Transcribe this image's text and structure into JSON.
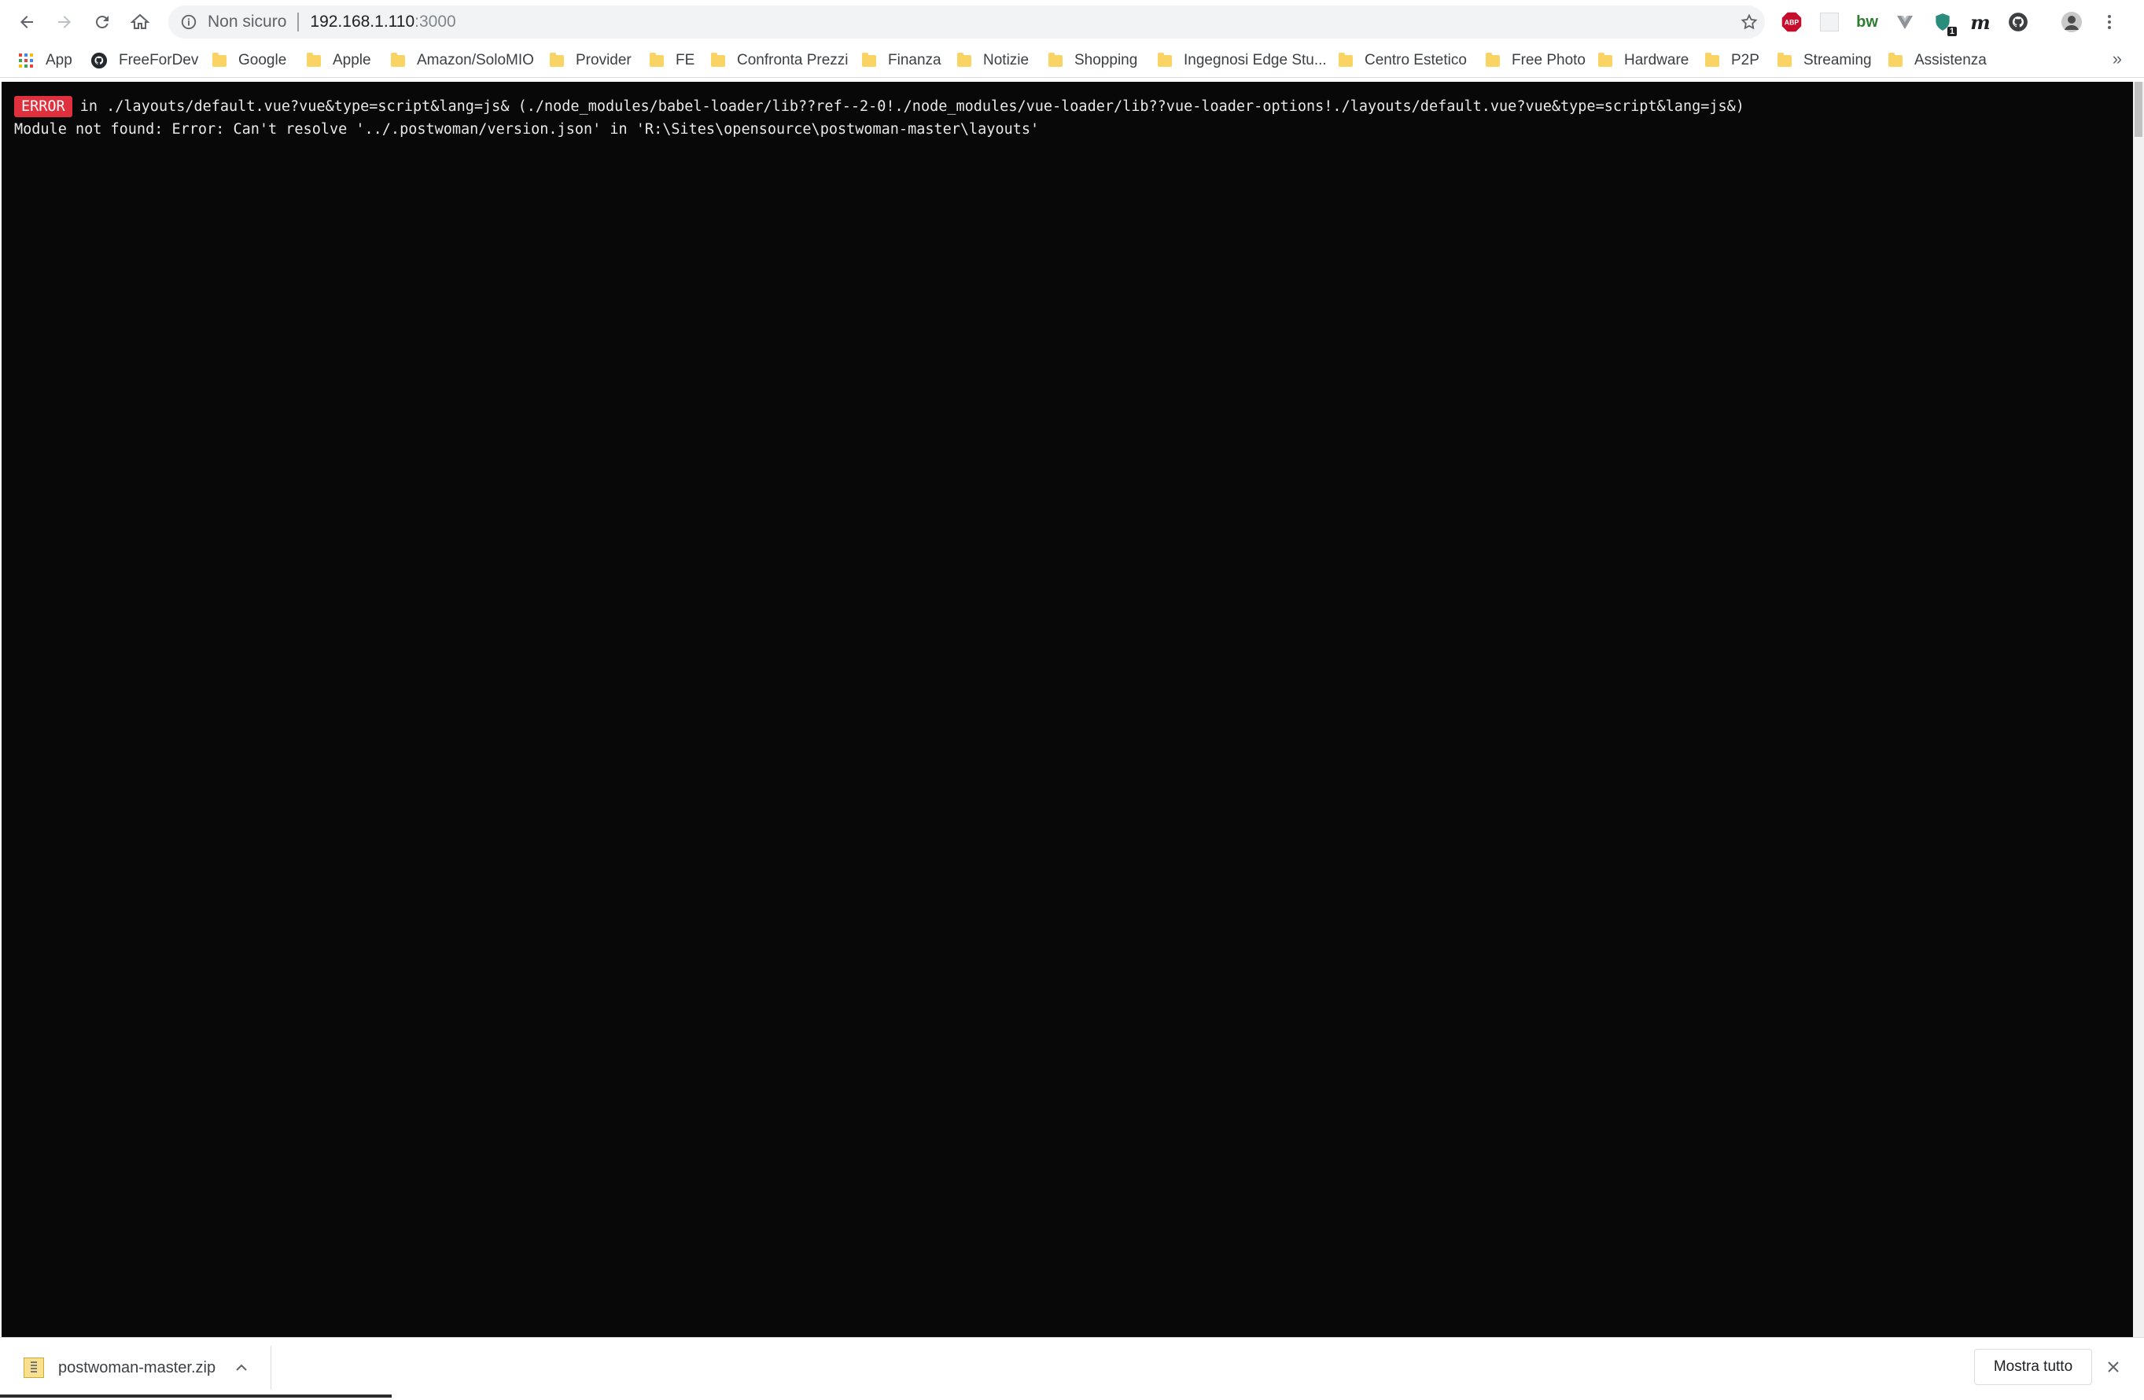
{
  "toolbar": {
    "security_label": "Non sicuro",
    "url_host": "192.168.1.110",
    "url_port": ":3000"
  },
  "extensions": {
    "abp_label": "ABP",
    "bw_label": "bw",
    "m_label": "m",
    "badge_count": "1"
  },
  "bookmarks": {
    "items": [
      {
        "label": "App",
        "icon": "apps-grid-icon"
      },
      {
        "label": "FreeForDev",
        "icon": "github-icon"
      },
      {
        "label": "Google",
        "icon": "folder-icon"
      },
      {
        "label": "Apple",
        "icon": "folder-icon"
      },
      {
        "label": "Amazon/SoloMIO",
        "icon": "folder-icon"
      },
      {
        "label": "Provider",
        "icon": "folder-icon"
      },
      {
        "label": "FE",
        "icon": "folder-icon"
      },
      {
        "label": "Confronta Prezzi",
        "icon": "folder-icon"
      },
      {
        "label": "Finanza",
        "icon": "folder-icon"
      },
      {
        "label": "Notizie",
        "icon": "folder-icon"
      },
      {
        "label": "Shopping",
        "icon": "folder-icon"
      },
      {
        "label": "Ingegnosi Edge Stu...",
        "icon": "folder-icon"
      },
      {
        "label": "Centro Estetico",
        "icon": "folder-icon"
      },
      {
        "label": "Free Photo",
        "icon": "folder-icon"
      },
      {
        "label": "Hardware",
        "icon": "folder-icon"
      },
      {
        "label": "P2P",
        "icon": "folder-icon"
      },
      {
        "label": "Streaming",
        "icon": "folder-icon"
      },
      {
        "label": "Assistenza",
        "icon": "folder-icon"
      }
    ],
    "more_label": "»"
  },
  "page": {
    "error_badge": "ERROR",
    "error_location": "in ./layouts/default.vue?vue&type=script&lang=js& (./node_modules/babel-loader/lib??ref--2-0!./node_modules/vue-loader/lib??vue-loader-options!./layouts/default.vue?vue&type=script&lang=js&)",
    "error_message": "Module not found: Error: Can't resolve '../.postwoman/version.json' in 'R:\\Sites\\opensource\\postwoman-master\\layouts'"
  },
  "download_shelf": {
    "file_name": "postwoman-master.zip",
    "show_all_label": "Mostra tutto"
  },
  "colors": {
    "error_badge_bg": "#e1303d",
    "page_bg": "#080808",
    "folder": "#f9d363"
  }
}
